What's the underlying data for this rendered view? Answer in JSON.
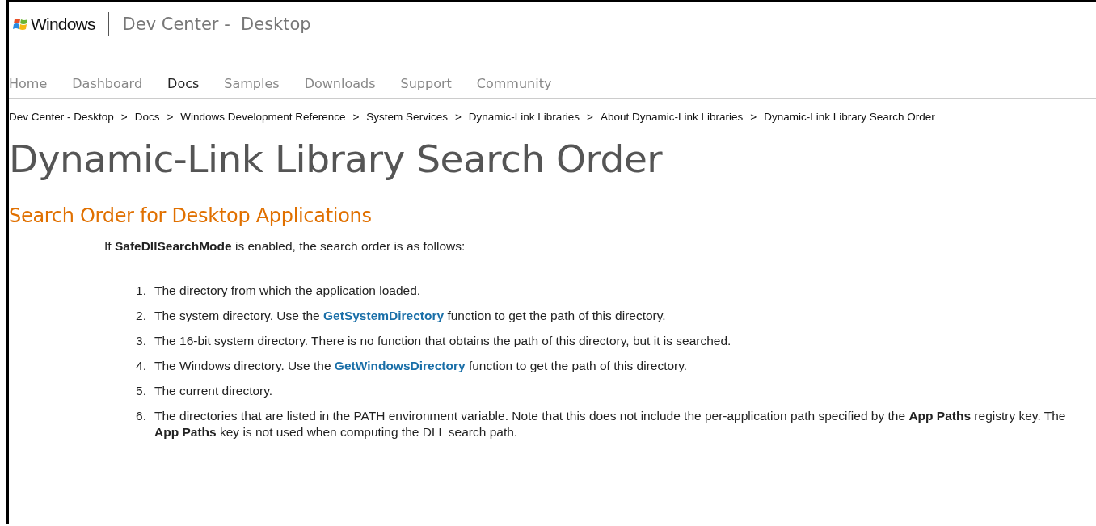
{
  "header": {
    "logo_text": "Windows",
    "site_title": "Dev Center -  Desktop"
  },
  "nav": [
    {
      "label": "Home",
      "selected": false
    },
    {
      "label": "Dashboard",
      "selected": false
    },
    {
      "label": "Docs",
      "selected": true
    },
    {
      "label": "Samples",
      "selected": false
    },
    {
      "label": "Downloads",
      "selected": false
    },
    {
      "label": "Support",
      "selected": false
    },
    {
      "label": "Community",
      "selected": false
    }
  ],
  "breadcrumb": [
    {
      "label": "Dev Center - Desktop",
      "separator": ">"
    },
    {
      "label": "Docs",
      "separator": ">"
    },
    {
      "label": "Windows Development Reference",
      "separator": ">"
    },
    {
      "label": "System Services",
      "separator": ">"
    },
    {
      "label": "Dynamic-Link Libraries",
      "separator": ">"
    },
    {
      "label": "About Dynamic-Link Libraries",
      "separator": ">"
    },
    {
      "label": "Dynamic-Link Library Search Order"
    }
  ],
  "title": "Dynamic-Link Library Search Order",
  "section_heading": "Search Order for Desktop Applications",
  "intro": "If **SafeDllSearchMode** is enabled, the search order is as follows:",
  "list": [
    {
      "number": "1.",
      "parts": [
        {
          "kind": "text",
          "text": "The directory from which the application loaded."
        }
      ]
    },
    {
      "number": "2.",
      "parts": [
        {
          "kind": "text",
          "text": "The system directory. Use the"
        },
        {
          "kind": "link",
          "text": "GetSystemDirectory"
        },
        {
          "kind": "text",
          "text": "function to get the path of this directory."
        }
      ]
    },
    {
      "number": "3.",
      "parts": [
        {
          "kind": "text",
          "text": "The 16-bit system directory. There is no function that obtains the path of this directory, but it is searched."
        }
      ]
    },
    {
      "number": "4.",
      "parts": [
        {
          "kind": "text",
          "text": "The Windows directory. Use the"
        },
        {
          "kind": "link",
          "text": "GetWindowsDirectory"
        },
        {
          "kind": "text",
          "text": "function to get the path of this directory."
        }
      ]
    },
    {
      "number": "5.",
      "parts": [
        {
          "kind": "text",
          "text": "The current directory."
        }
      ]
    },
    {
      "number": "6.",
      "parts": [
        {
          "kind": "text",
          "text": "The directories that are listed in the PATH environment variable. Note that this does not include the per-application path specified by the **App Paths** registry key. The **App Paths** key is not used when computing the DLL search path."
        }
      ]
    }
  ]
}
